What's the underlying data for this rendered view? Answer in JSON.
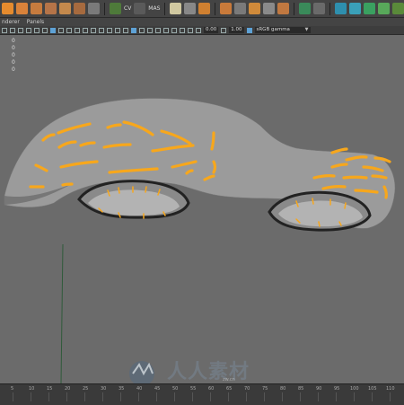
{
  "menubar": {
    "items": [
      "nderer",
      "Panels"
    ]
  },
  "shelf": {
    "text_icons": {
      "cv": "CV",
      "mas": "MAS"
    },
    "number_badge": "-1"
  },
  "viewport_toolbar": {
    "field_1": "0.00",
    "field_2": "1.00",
    "color_space": "sRGB gamma"
  },
  "hud": {
    "values": [
      "0",
      "0",
      "0",
      "0",
      "0"
    ]
  },
  "timeline": {
    "labels": [
      "5",
      "10",
      "15",
      "20",
      "25",
      "30",
      "35",
      "40",
      "45",
      "50",
      "55",
      "60",
      "65",
      "70",
      "75",
      "80",
      "85",
      "90",
      "95",
      "100",
      "105",
      "110"
    ]
  },
  "watermark": {
    "text": "人人素材",
    "sub": "zw.cn"
  },
  "colors": {
    "viewport_bg": "#6b6b6b",
    "stroke": "#f7a71c",
    "surface": "#9d9d9d",
    "selection": "#5ea2d6"
  }
}
